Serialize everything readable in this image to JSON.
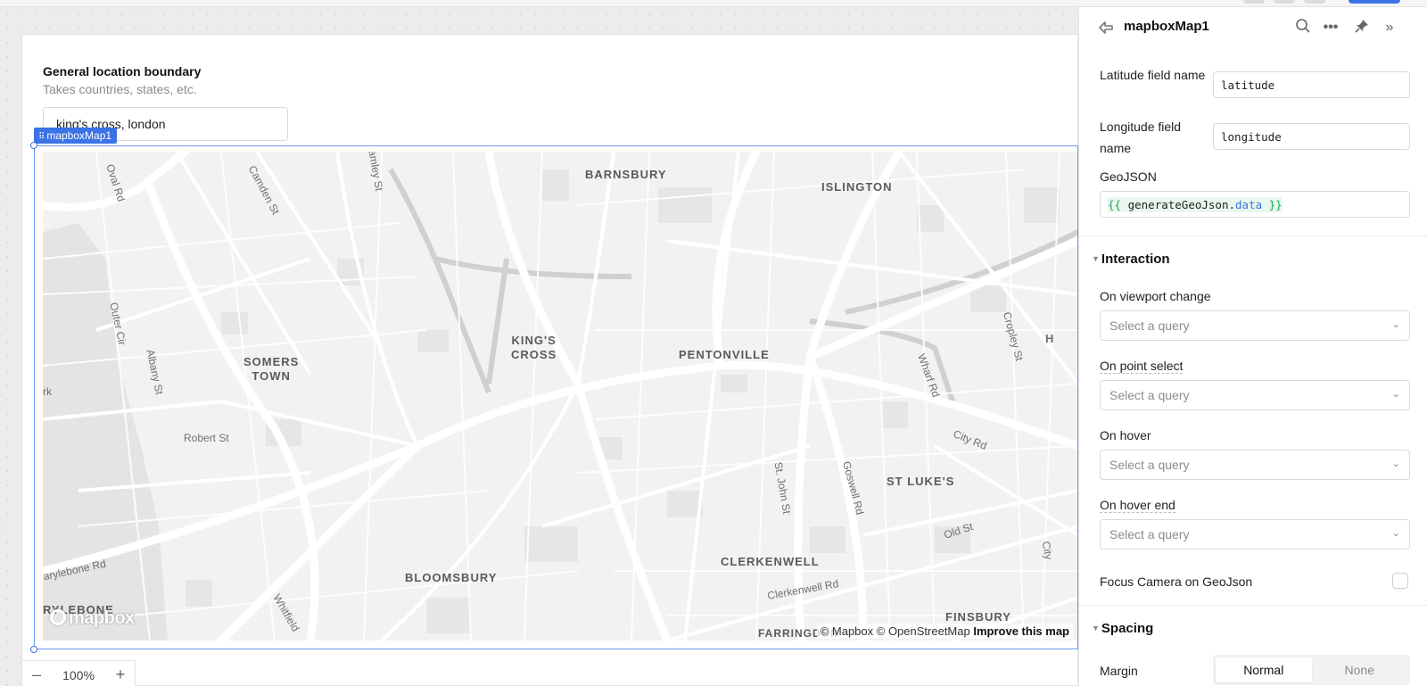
{
  "app": {
    "field_title": "General location boundary",
    "field_subtitle": "Takes countries, states, etc.",
    "location_value": "king's cross, london",
    "component_tag": "mapboxMap1",
    "zoom": {
      "minus": "–",
      "value": "100%",
      "plus": "+"
    }
  },
  "map": {
    "areas": [
      {
        "id": "barnsbury",
        "label": "BARNSBURY"
      },
      {
        "id": "islington",
        "label": "ISLINGTON"
      },
      {
        "id": "kings-cross",
        "label": "KING'S\nCROSS"
      },
      {
        "id": "pentonville",
        "label": "PENTONVILLE"
      },
      {
        "id": "somers-town",
        "label": "SOMERS\nTOWN"
      },
      {
        "id": "st-lukes",
        "label": "ST LUKE'S"
      },
      {
        "id": "bloomsbury",
        "label": "BLOOMSBURY"
      },
      {
        "id": "clerkenwell",
        "label": "CLERKENWELL"
      },
      {
        "id": "finsbury",
        "label": "FINSBURY"
      },
      {
        "id": "marylebone",
        "label": "RYLEBONE"
      },
      {
        "id": "farringdon",
        "label": "FARRINGDON"
      }
    ],
    "streets": [
      {
        "id": "oval-rd",
        "label": "Oval Rd"
      },
      {
        "id": "camden-st",
        "label": "Camden St"
      },
      {
        "id": "outer-cir",
        "label": "Outer Cir"
      },
      {
        "id": "albany-st",
        "label": "Albany St"
      },
      {
        "id": "robert-st",
        "label": "Robert St"
      },
      {
        "id": "st-john-st",
        "label": "St. John St"
      },
      {
        "id": "goswell-rd",
        "label": "Goswell Rd"
      },
      {
        "id": "city-rd",
        "label": "City Rd"
      },
      {
        "id": "old-st",
        "label": "Old St"
      },
      {
        "id": "clerkenwell-rd",
        "label": "Clerkenwell Rd"
      },
      {
        "id": "wharf-rd",
        "label": "Wharf Rd"
      },
      {
        "id": "cropley-st",
        "label": "Cropley St"
      },
      {
        "id": "marylebone-rd",
        "label": "arylebone Rd"
      },
      {
        "id": "whitfield",
        "label": "Whitfield"
      },
      {
        "id": "amley-st",
        "label": "amley St"
      },
      {
        "id": "park",
        "label": "rk"
      },
      {
        "id": "h-edge",
        "label": "H"
      },
      {
        "id": "city-edge",
        "label": "City"
      }
    ],
    "logo": "mapbox",
    "attribution": "© Mapbox © OpenStreetMap",
    "improve": "Improve this map"
  },
  "panel": {
    "component_name": "mapboxMap1",
    "latitude_label": "Latitude field name",
    "latitude_value": "latitude",
    "longitude_label": "Longitude field name",
    "longitude_value": "longitude",
    "geojson_label": "GeoJSON",
    "geojson_open": "{{",
    "geojson_obj": "generateGeoJson",
    "geojson_dot": ".",
    "geojson_prop": "data",
    "geojson_close": "}}",
    "interaction_title": "Interaction",
    "events": [
      {
        "label": "On viewport change",
        "placeholder": "Select a query"
      },
      {
        "label": "On point select",
        "placeholder": "Select a query"
      },
      {
        "label": "On hover",
        "placeholder": "Select a query"
      },
      {
        "label": "On hover end",
        "placeholder": "Select a query"
      }
    ],
    "focus_label": "Focus Camera on GeoJson",
    "spacing_title": "Spacing",
    "margin_label": "Margin",
    "margin_options": [
      "Normal",
      "None"
    ],
    "margin_selected": "Normal"
  }
}
